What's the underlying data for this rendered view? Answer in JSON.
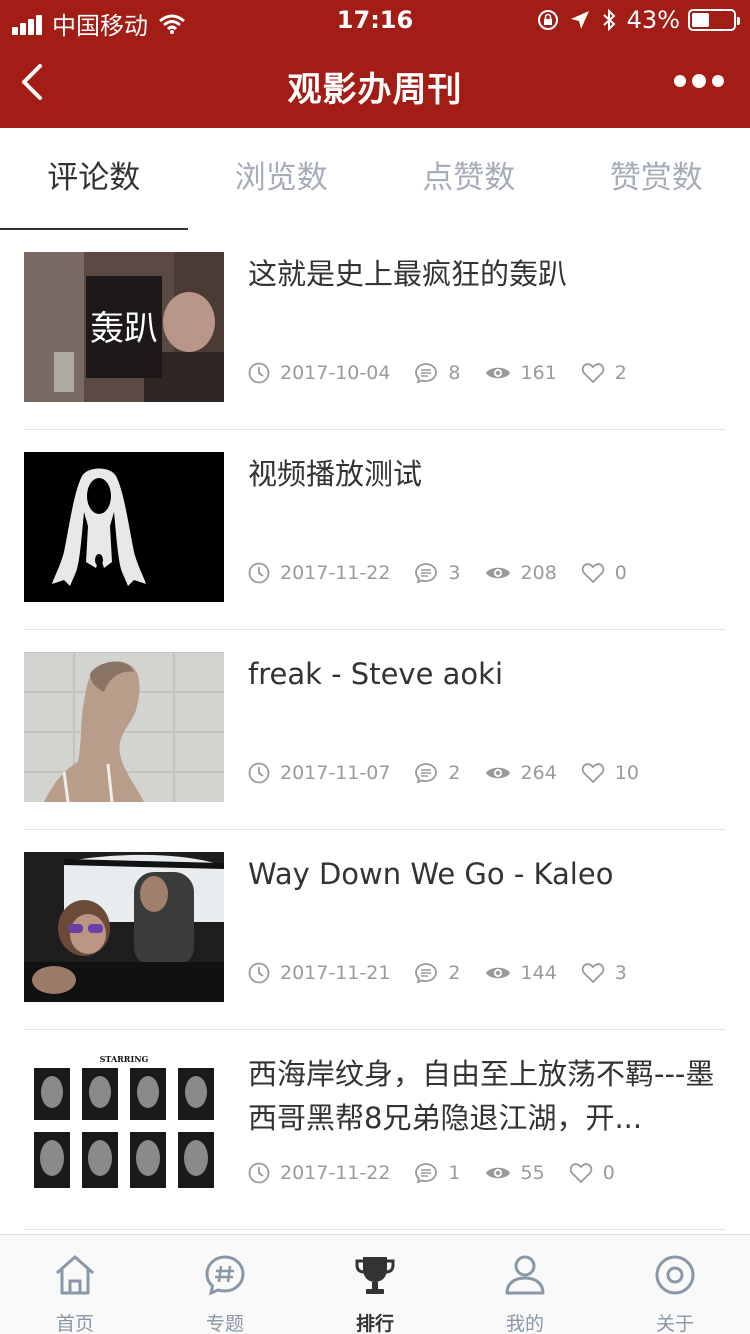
{
  "status": {
    "carrier": "中国移动",
    "time": "17:16",
    "battery_text": "43%",
    "battery_level": 0.43
  },
  "nav": {
    "title": "观影办周刊",
    "back_icon": "chevron-left-icon",
    "more_icon": "ellipsis-icon"
  },
  "tabs": [
    {
      "label": "评论数",
      "active": true
    },
    {
      "label": "浏览数",
      "active": false
    },
    {
      "label": "点赞数",
      "active": false
    },
    {
      "label": "赞赏数",
      "active": false
    }
  ],
  "articles": [
    {
      "title": "这就是史上最疯狂的轰趴",
      "date": "2017-10-04",
      "comments": "8",
      "views": "161",
      "likes": "2",
      "thumb_caption": "轰趴"
    },
    {
      "title": "视频播放测试",
      "date": "2017-11-22",
      "comments": "3",
      "views": "208",
      "likes": "0"
    },
    {
      "title": "freak - Steve aoki",
      "date": "2017-11-07",
      "comments": "2",
      "views": "264",
      "likes": "10"
    },
    {
      "title": "Way Down We Go - Kaleo",
      "date": "2017-11-21",
      "comments": "2",
      "views": "144",
      "likes": "3"
    },
    {
      "title": "西海岸纹身，自由至上放荡不羁---墨西哥黑帮8兄弟隐退江湖，开...",
      "date": "2017-11-22",
      "comments": "1",
      "views": "55",
      "likes": "0",
      "thumb_caption": "STARRING"
    }
  ],
  "tabbar": [
    {
      "label": "首页",
      "icon": "home-icon",
      "active": false
    },
    {
      "label": "专题",
      "icon": "topic-hash-icon",
      "active": false
    },
    {
      "label": "排行",
      "icon": "trophy-icon",
      "active": true
    },
    {
      "label": "我的",
      "icon": "user-icon",
      "active": false
    },
    {
      "label": "关于",
      "icon": "about-circle-icon",
      "active": false
    }
  ],
  "colors": {
    "header": "#a21d16",
    "tab_active": "#333333",
    "tab_inactive": "#a7adb8",
    "meta": "#9a9a9a"
  }
}
